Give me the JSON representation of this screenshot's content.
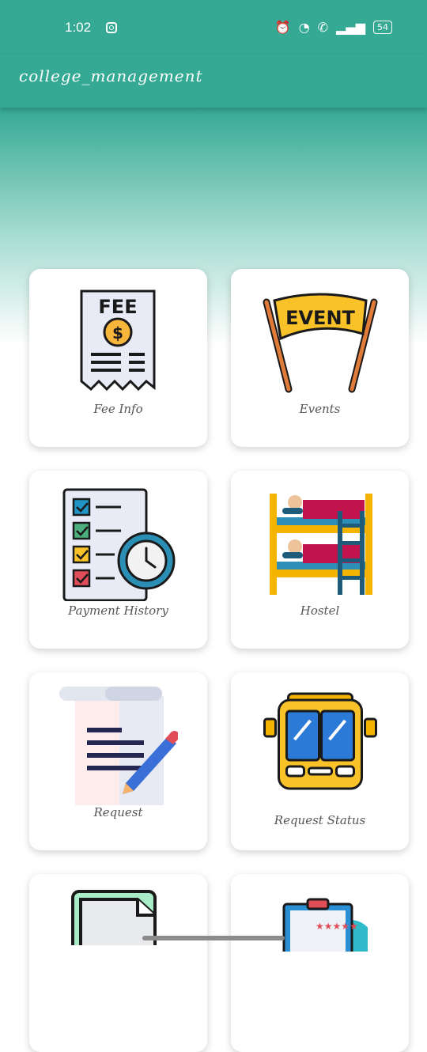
{
  "status_bar": {
    "time": "1:02",
    "battery": "54"
  },
  "app_bar": {
    "title": "college_management"
  },
  "cards": {
    "fee": {
      "label": "Fee Info",
      "icon_text": "FEE"
    },
    "events": {
      "label": "Events",
      "icon_text": "EVENT"
    },
    "payment": {
      "label": "Payment History"
    },
    "hostel": {
      "label": "Hostel"
    },
    "request": {
      "label": "Request"
    },
    "request_status": {
      "label": "Request Status"
    }
  },
  "colors": {
    "primary": "#35a994",
    "card_bg": "#ffffff"
  }
}
